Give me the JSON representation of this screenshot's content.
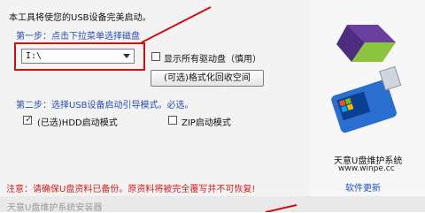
{
  "intro_text": "本工具将使您的USB设备完美启动。",
  "step1_text": "第一步：点击下拉菜单选择磁盘",
  "drive_select": {
    "value": "I:\\"
  },
  "show_all_drives": {
    "label": "显示所有驱动盘（慎用）",
    "checked": false
  },
  "format_button": {
    "label": "(可选)格式化回收空间"
  },
  "step2_text": "第二步：选择USB设备启动引导模式。必选。",
  "hdd_mode": {
    "label": "(已选)HDD启动模式",
    "checked": true
  },
  "zip_mode": {
    "label": "ZIP启动模式",
    "checked": false
  },
  "warning_text": "注意：请确保U盘资料已备份。原资料将被完全覆写并不可恢复!",
  "brand_name": "天意U盘维护系统",
  "website": "www.winpe.cc",
  "update_link": "软件更新",
  "footer_title": "天意U盘维护系统安装器",
  "colors": {
    "highlight_red": "#cc1111",
    "step_blue": "#2a4db0",
    "warning_red": "#d02020"
  }
}
